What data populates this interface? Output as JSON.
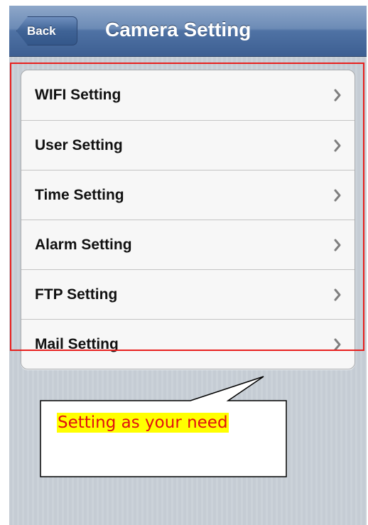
{
  "navbar": {
    "back_label": "Back",
    "title": "Camera Setting"
  },
  "settings": {
    "items": [
      {
        "label": "WIFI Setting"
      },
      {
        "label": "User Setting"
      },
      {
        "label": "Time Setting"
      },
      {
        "label": "Alarm Setting"
      },
      {
        "label": "FTP Setting"
      },
      {
        "label": "Mail Setting"
      }
    ]
  },
  "annotation": {
    "callout_text": "Setting as your need",
    "highlight_color": "#e8201e",
    "text_color": "#e01010",
    "text_background": "#ffff00"
  },
  "icons": {
    "row_disclosure": "chevron-right-icon"
  }
}
